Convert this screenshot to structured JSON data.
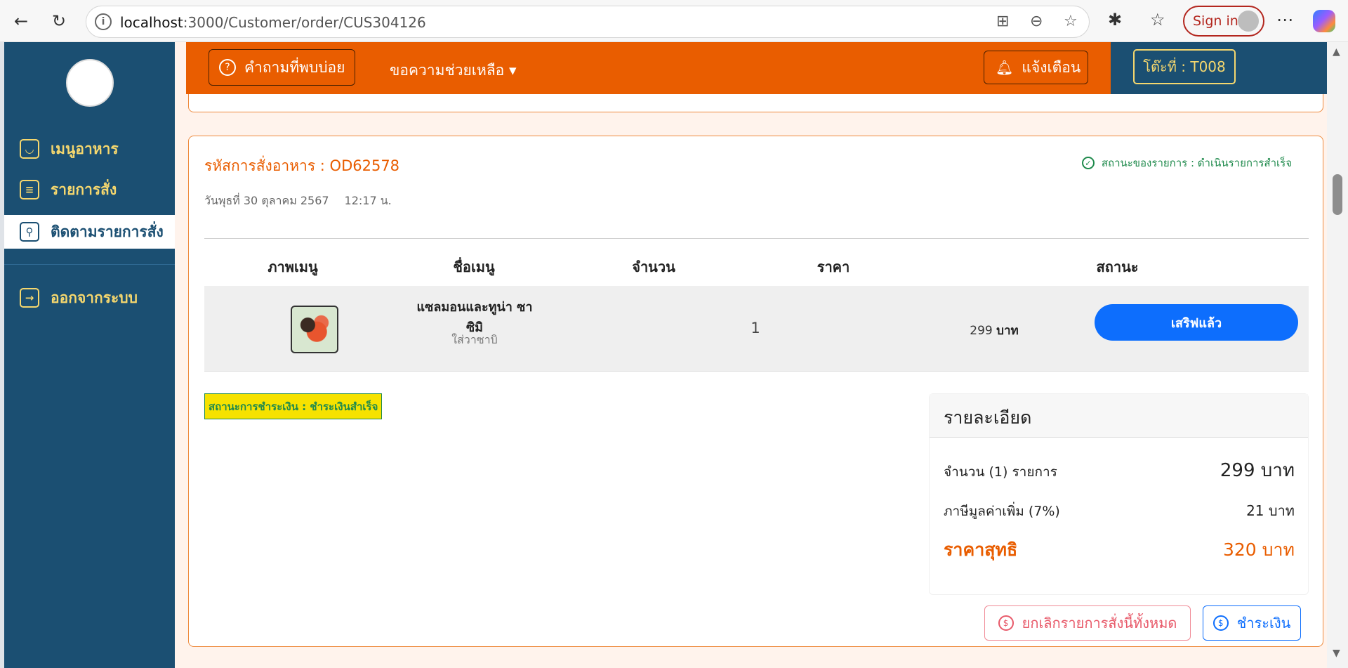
{
  "browser": {
    "url_host": "localhost",
    "url_path": ":3000/Customer/order/CUS304126",
    "signin_label": "Sign in"
  },
  "sidebar": {
    "items": [
      {
        "label": "เมนูอาหาร",
        "icon": "food-bowl-icon"
      },
      {
        "label": "รายการสั่ง",
        "icon": "order-list-icon"
      },
      {
        "label": "ติดตามรายการสั่ง",
        "icon": "tracking-icon"
      },
      {
        "label": "ออกจากระบบ",
        "icon": "logout-icon"
      }
    ]
  },
  "topbar": {
    "faq_label": "คำถามที่พบบ่อย",
    "help_label": "ขอความช่วยเหลือ ▾",
    "notify_label": "แจ้งเตือน",
    "table_label": "โต๊ะที่ : T008"
  },
  "order": {
    "code_label": "รหัสการสั่งอาหาร : OD62578",
    "status_label": "สถานะของรายการ : ดำเนินรายการสำเร็จ",
    "date": "วันพุธที่ 30 ตุลาคม 2567",
    "time": "12:17 น.",
    "columns": [
      "ภาพเมนู",
      "ชื่อเมนู",
      "จำนวน",
      "ราคา",
      "สถานะ"
    ],
    "items": [
      {
        "name": "แซลมอนและทูน่า ซาซิมิ",
        "note": "ใส่วาซาบิ",
        "qty": "1",
        "price": "299",
        "price_unit": "บาท",
        "status_button": "เสริฟแล้ว"
      }
    ],
    "payment_status": "สถานะการชำระเงิน : ชำระเงินสำเร็จ"
  },
  "detail": {
    "title": "รายละเอียด",
    "count_label": "จำนวน (1) รายการ",
    "subtotal": "299 บาท",
    "vat_label": "ภาษีมูลค่าเพิ่ม (7%)",
    "vat_value": "21 บาท",
    "total_label": "ราคาสุทธิ",
    "total_value": "320 บาท"
  },
  "actions": {
    "cancel_label": "ยกเลิกรายการสั่งนี้ทั้งหมด",
    "pay_label": "ชำระเงิน"
  },
  "colors": {
    "accent": "#e95d00",
    "sidebar": "#1b4f72",
    "primary": "#0d6efd",
    "success": "#1f8a4c"
  }
}
